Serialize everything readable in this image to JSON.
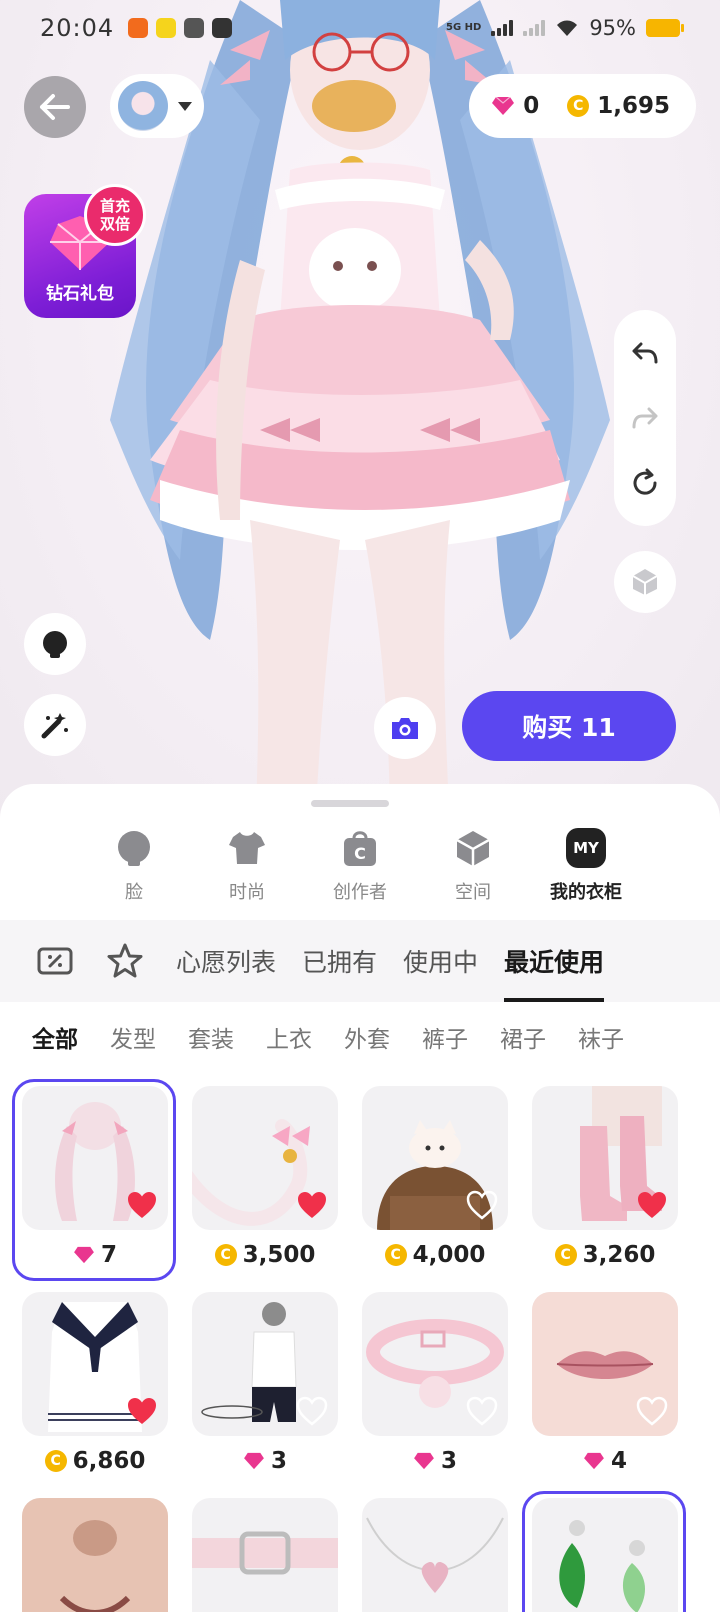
{
  "status_bar": {
    "time": "20:04",
    "network": "5G HD",
    "battery": "95%"
  },
  "currency": {
    "gems": "0",
    "coins": "1,695"
  },
  "promo": {
    "label": "钻石礼包",
    "badge_line1": "首充",
    "badge_line2": "双倍"
  },
  "buy_button": {
    "label": "购买 11"
  },
  "categories": [
    {
      "label": "脸",
      "icon": "face-icon"
    },
    {
      "label": "时尚",
      "icon": "tshirt-icon"
    },
    {
      "label": "创作者",
      "icon": "creator-bag-icon"
    },
    {
      "label": "空间",
      "icon": "space-cube-icon"
    },
    {
      "label": "我的衣柜",
      "icon": "my-badge",
      "badge": "MY",
      "active": true
    }
  ],
  "filter_tabs": [
    {
      "label": "心愿列表"
    },
    {
      "label": "已拥有"
    },
    {
      "label": "使用中"
    },
    {
      "label": "最近使用",
      "active": true
    }
  ],
  "sub_tabs": [
    "全部",
    "发型",
    "套装",
    "上衣",
    "外套",
    "裤子",
    "裙子",
    "袜子"
  ],
  "items": [
    {
      "currency": "gem",
      "price": "7",
      "favorited": true,
      "selected": true,
      "thumb": "pink-twin-tail-hair"
    },
    {
      "currency": "coin",
      "price": "3,500",
      "favorited": true,
      "thumb": "cat-tail-with-bow"
    },
    {
      "currency": "coin",
      "price": "4,000",
      "favorited": false,
      "thumb": "cat-hat-brown-hair"
    },
    {
      "currency": "coin",
      "price": "3,260",
      "favorited": true,
      "thumb": "pink-leg-warmers"
    },
    {
      "currency": "coin",
      "price": "6,860",
      "favorited": true,
      "thumb": "sailor-dress"
    },
    {
      "currency": "gem",
      "price": "3",
      "favorited": false,
      "thumb": "tshirt-shorts-outfit"
    },
    {
      "currency": "gem",
      "price": "3",
      "favorited": false,
      "thumb": "pink-bell-collar"
    },
    {
      "currency": "gem",
      "price": "4",
      "favorited": false,
      "thumb": "pink-lips"
    },
    {
      "currency": "none",
      "price": "",
      "favorited": false,
      "thumb": "face-nose-mouth"
    },
    {
      "currency": "none",
      "price": "",
      "favorited": false,
      "thumb": "pink-belt"
    },
    {
      "currency": "none",
      "price": "",
      "favorited": false,
      "thumb": "heart-necklace"
    },
    {
      "currency": "none",
      "price": "",
      "favorited": false,
      "selected": true,
      "thumb": "green-leaf-earrings"
    }
  ],
  "colors": {
    "accent": "#5b47f0",
    "heart_red": "#f0304a",
    "coin": "#f5b700",
    "gem": "#e9368f"
  }
}
